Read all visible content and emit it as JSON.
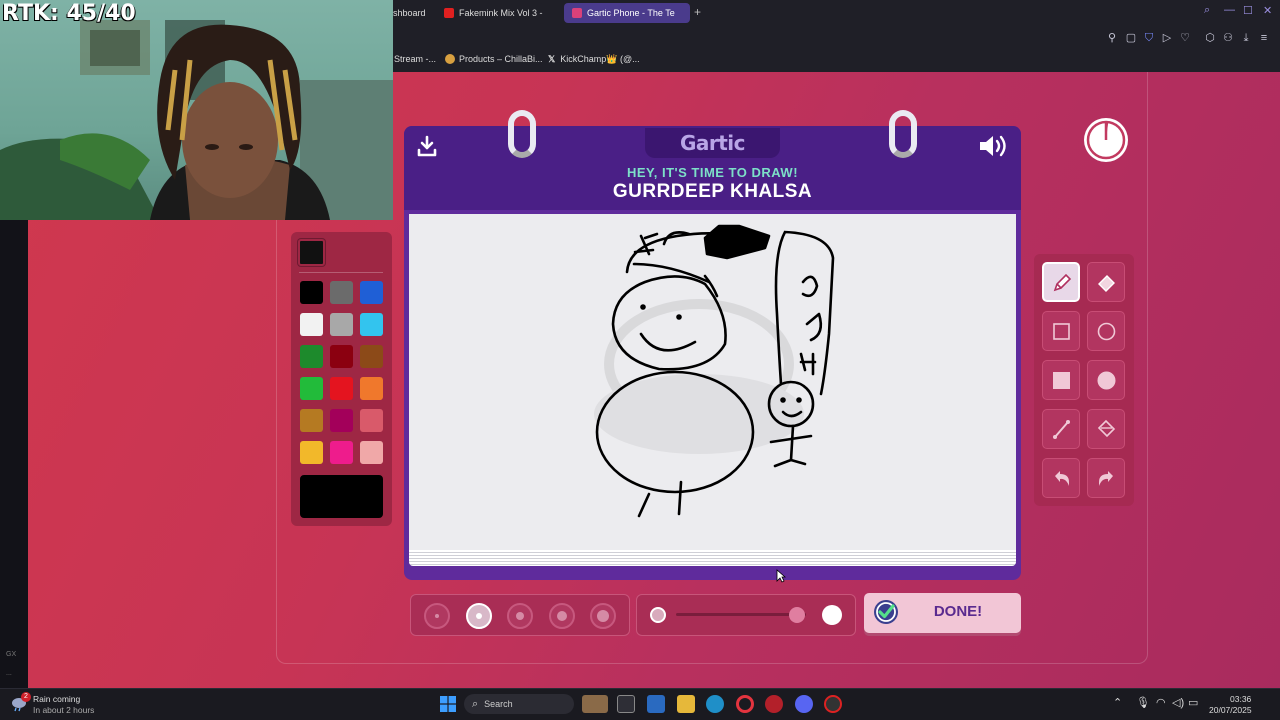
{
  "browser": {
    "tabs": [
      {
        "label": "shboard",
        "icon": "dashboard-icon",
        "color": "#888"
      },
      {
        "label": "Fakemink Mix Vol 3 -",
        "icon": "youtube-icon",
        "color": "#e02020"
      },
      {
        "label": "Gartic Phone - The Te",
        "icon": "phone-icon",
        "color": "#d9417a",
        "active": true
      }
    ],
    "bookmarks": [
      {
        "label": "Stream -...",
        "color": "#555"
      },
      {
        "label": "Products – ChillaBi...",
        "color": "#d8a040"
      },
      {
        "label": "KickChamp👑 (@...",
        "color": "#fff"
      }
    ]
  },
  "webcam": {
    "counter": "RTK: 45/40"
  },
  "game": {
    "logo": "Gartic",
    "prompt_small": "HEY, IT'S TIME TO DRAW!",
    "prompt_big": "GURRDEEP KHALSA",
    "done_label": "DONE!",
    "current_color": "#111111",
    "selected_color_preview": "#000000",
    "palette": [
      "#000000",
      "#6b6b6b",
      "#1f5fd6",
      "#f2f2f2",
      "#a8a8a8",
      "#33c4ee",
      "#1d8a2c",
      "#8b0010",
      "#8c4a18",
      "#22bb3a",
      "#e4141f",
      "#f0782c",
      "#b57a22",
      "#a3005a",
      "#d95a6a",
      "#f2b82a",
      "#ee1c8c",
      "#f0a8a8"
    ],
    "timer_remaining_fraction": 0.98,
    "brush_sizes": [
      1,
      2,
      3,
      4,
      5
    ],
    "selected_brush_size": 2,
    "opacity_fraction": 0.93,
    "tools": [
      {
        "name": "pencil",
        "selected": true
      },
      {
        "name": "eraser"
      },
      {
        "name": "rectangle-outline"
      },
      {
        "name": "ellipse-outline"
      },
      {
        "name": "rectangle-filled"
      },
      {
        "name": "ellipse-filled"
      },
      {
        "name": "line"
      },
      {
        "name": "fill-bucket"
      },
      {
        "name": "undo"
      },
      {
        "name": "redo"
      }
    ]
  },
  "taskbar": {
    "weather_badge": "2",
    "weather_title": "Rain coming",
    "weather_sub": "In about 2 hours",
    "search_label": "Search",
    "time": "03:36",
    "date": "20/07/2025"
  },
  "sidebar": {
    "label_top": "GX",
    "label_bottom": "..."
  }
}
